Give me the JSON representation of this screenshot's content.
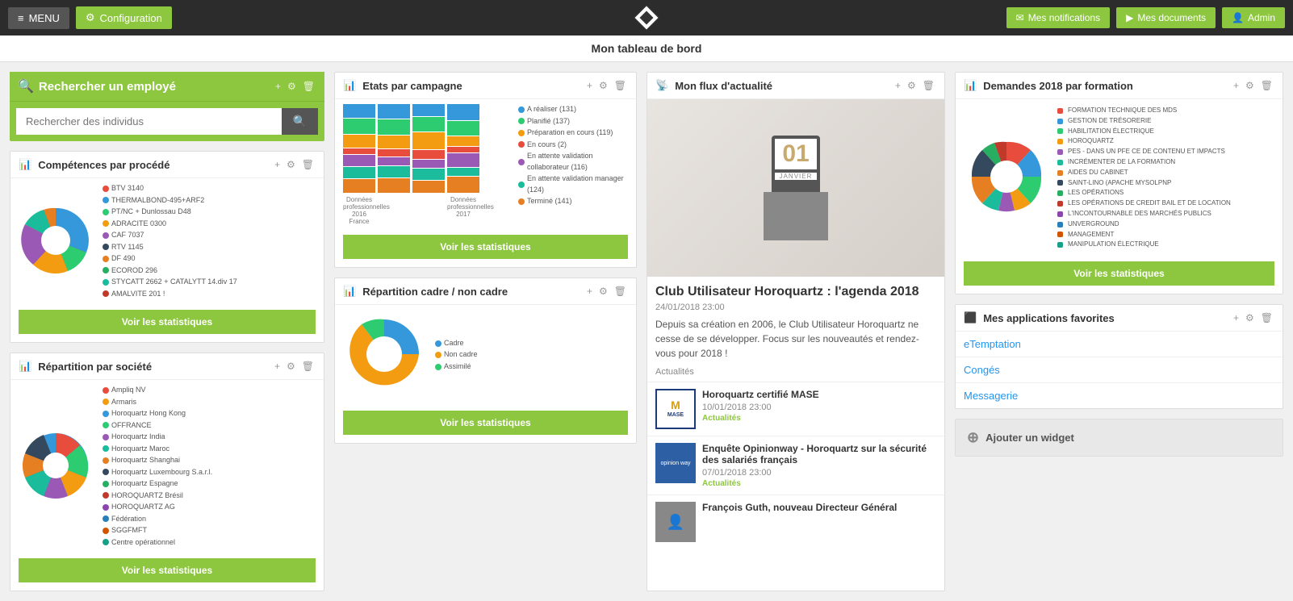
{
  "navbar": {
    "menu_label": "MENU",
    "config_label": "Configuration",
    "notifications_label": "Mes notifications",
    "documents_label": "Mes documents",
    "admin_label": "Admin"
  },
  "page_title": "Mon tableau de bord",
  "search_widget": {
    "title": "Rechercher un employé",
    "placeholder": "Rechercher des individus"
  },
  "competences_widget": {
    "title": "Compétences par procédé",
    "btn_label": "Voir les statistiques",
    "legend": [
      {
        "label": "BTV 3140",
        "color": "#e74c3c"
      },
      {
        "label": "THERMALBOND-495+ARF2",
        "color": "#3498db"
      },
      {
        "label": "PT/NC + Dunlossau D48",
        "color": "#2ecc71"
      },
      {
        "label": "ADRACITE 0300",
        "color": "#f39c12"
      },
      {
        "label": "CAF 7037",
        "color": "#9b59b6"
      },
      {
        "label": "RTV 1145",
        "color": "#1abc9c"
      },
      {
        "label": "ECOROD 296",
        "color": "#e67e22"
      },
      {
        "label": "AMALVITE 201 !",
        "color": "#34495e"
      }
    ]
  },
  "etats_widget": {
    "title": "Etats par campagne",
    "btn_label": "Voir les statistiques",
    "legend": [
      {
        "label": "A réaliser (131)",
        "color": "#3498db"
      },
      {
        "label": "Planifié (137)",
        "color": "#2ecc71"
      },
      {
        "label": "Préparation en cours (119)",
        "color": "#f39c12"
      },
      {
        "label": "En cours (2)",
        "color": "#e74c3c"
      },
      {
        "label": "En attente validation collaborateur (116)",
        "color": "#9b59b6"
      },
      {
        "label": "En attente validation manager (124)",
        "color": "#1abc9c"
      },
      {
        "label": "Terminé (141)",
        "color": "#e67e22"
      }
    ]
  },
  "repartition_societe_widget": {
    "title": "Répartition par société",
    "btn_label": "Voir les statistiques",
    "legend": [
      {
        "label": "Ampliq NV",
        "color": "#e74c3c"
      },
      {
        "label": "Armaris",
        "color": "#3498db"
      },
      {
        "label": "Horoquartz Hong Kong",
        "color": "#2ecc71"
      },
      {
        "label": "OFFRANCE",
        "color": "#f39c12"
      },
      {
        "label": "Horoquartz India",
        "color": "#9b59b6"
      },
      {
        "label": "Horoquartz Maroc",
        "color": "#1abc9c"
      },
      {
        "label": "Horoquartz Shanghai",
        "color": "#e67e22"
      },
      {
        "label": "Horoquartz Luxembourg S.a.r.l.",
        "color": "#34495e"
      },
      {
        "label": "Horoquartz Espagne",
        "color": "#27ae60"
      },
      {
        "label": "HOROQUARTZ Brésil",
        "color": "#c0392b"
      },
      {
        "label": "HOROQUARTZ AG",
        "color": "#8e44ad"
      },
      {
        "label": "Fédération",
        "color": "#2980b9"
      },
      {
        "label": "SGGFMFT",
        "color": "#d35400"
      },
      {
        "label": "Centre opérationnel",
        "color": "#16a085"
      }
    ]
  },
  "repartition_cadre_widget": {
    "title": "Répartition cadre / non cadre",
    "btn_label": "Voir les statistiques",
    "legend": [
      {
        "label": "Cadre",
        "color": "#3498db"
      },
      {
        "label": "Non cadre",
        "color": "#f39c12"
      },
      {
        "label": "Assimilé",
        "color": "#2ecc71"
      }
    ]
  },
  "flux_actualite_widget": {
    "title": "Mon flux d'actualité",
    "main_news": {
      "title": "Club Utilisateur Horoquartz : l'agenda 2018",
      "date": "24/01/2018 23:00",
      "excerpt": "Depuis sa création en 2006, le Club Utilisateur Horoquartz ne cesse de se développer. Focus sur les nouveautés et rendez-vous pour 2018 !",
      "category": "Actualités"
    },
    "news_items": [
      {
        "title": "Horoquartz certifié MASE",
        "date": "10/01/2018 23:00",
        "category": "Actualités",
        "thumb_type": "mase"
      },
      {
        "title": "Enquête Opinionway - Horoquartz sur la sécurité des salariés français",
        "date": "07/01/2018 23:00",
        "category": "Actualités",
        "thumb_type": "opinion"
      },
      {
        "title": "François Guth, nouveau Directeur Général",
        "date": "",
        "category": "",
        "thumb_type": "person"
      }
    ]
  },
  "demandes_widget": {
    "title": "Demandes 2018 par formation",
    "btn_label": "Voir les statistiques",
    "legend": [
      {
        "label": "FORMATION TECHNIQUE DES MDS",
        "color": "#e74c3c"
      },
      {
        "label": "GESTION DE TRÉSORERIE",
        "color": "#3498db"
      },
      {
        "label": "HABILITATION ÉLECTRIQUE",
        "color": "#2ecc71"
      },
      {
        "label": "HOROQUARTZ",
        "color": "#f39c12"
      },
      {
        "label": "PES - DANS UN PFE CE DE CONTENU ET IMPACTS",
        "color": "#9b59b6"
      },
      {
        "label": "INCRÉMENTER DE LA FORMATION",
        "color": "#1abc9c"
      },
      {
        "label": "AIDES DU CABINET",
        "color": "#e67e22"
      },
      {
        "label": "SAINT-LINO (APACHE MYSOLPNP",
        "color": "#34495e"
      },
      {
        "label": "LES OPÉRATIONS",
        "color": "#27ae60"
      },
      {
        "label": "LES OPÉRATIONS DE CREDIT BAIL ET DE LOCATION",
        "color": "#c0392b"
      },
      {
        "label": "L'INCONTOURNABLE DES MARCHÉS PUBLICS",
        "color": "#8e44ad"
      },
      {
        "label": "UNVERGROUND",
        "color": "#2980b9"
      },
      {
        "label": "MANAGEMENT",
        "color": "#d35400"
      },
      {
        "label": "MANIPULATION ÉLECTRIQUE",
        "color": "#16a085"
      }
    ]
  },
  "fav_apps_widget": {
    "title": "Mes applications favorites",
    "apps": [
      {
        "label": "eTemptation"
      },
      {
        "label": "Congés"
      },
      {
        "label": "Messagerie"
      }
    ]
  },
  "add_widget": {
    "label": "Ajouter un widget"
  }
}
